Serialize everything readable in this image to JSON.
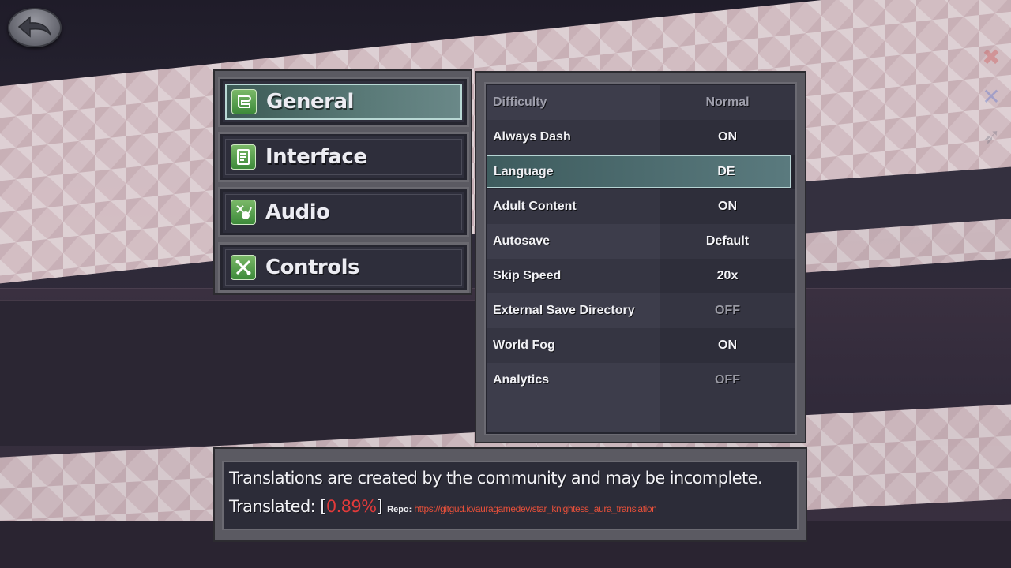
{
  "back_button": {
    "icon": "back-arrow-icon"
  },
  "menu": {
    "items": [
      {
        "label": "General",
        "icon": "general-icon",
        "active": true
      },
      {
        "label": "Interface",
        "icon": "interface-icon",
        "active": false
      },
      {
        "label": "Audio",
        "icon": "audio-icon",
        "active": false
      },
      {
        "label": "Controls",
        "icon": "controls-icon",
        "active": false
      }
    ]
  },
  "settings": {
    "rows": [
      {
        "label": "Difficulty",
        "value": "Normal"
      },
      {
        "label": "Always Dash",
        "value": "ON"
      },
      {
        "label": "Language",
        "value": "DE"
      },
      {
        "label": "Adult Content",
        "value": "ON"
      },
      {
        "label": "Autosave",
        "value": "Default"
      },
      {
        "label": "Skip Speed",
        "value": "20x"
      },
      {
        "label": "External Save Directory",
        "value": "OFF"
      },
      {
        "label": "World Fog",
        "value": "ON"
      },
      {
        "label": "Analytics",
        "value": "OFF"
      }
    ],
    "selected": "Language"
  },
  "info": {
    "line1": "Translations are created by the community and may be incomplete.",
    "translated_label": "Translated: [",
    "translated_pct": "0.89%",
    "translated_close": "]",
    "repo_label": "Repo:",
    "repo_url": "https://gitgud.io/auragamedev/star_knightess_aura_translation"
  },
  "colors": {
    "accent_selected": "#5a7a7e",
    "percent_red": "#e23a3a",
    "link_red": "#e8503a"
  }
}
